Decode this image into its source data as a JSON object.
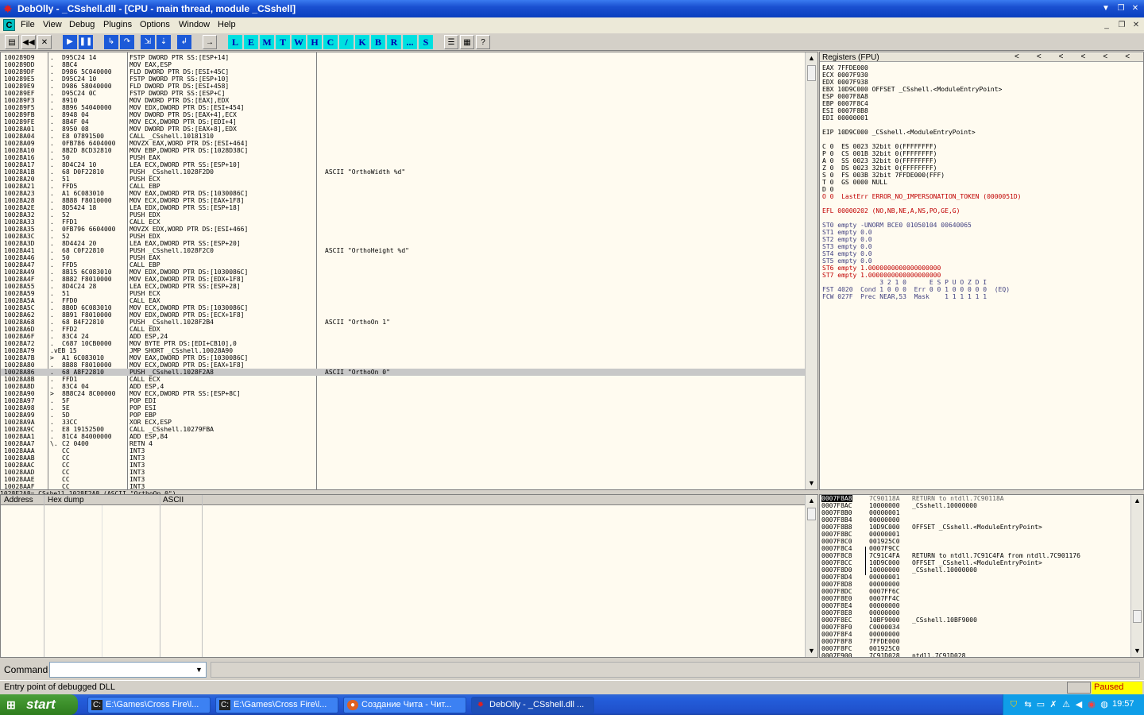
{
  "titlebar": {
    "title": "DebOlly - _CSshell.dll - [CPU - main thread, module _CSshell]"
  },
  "menu": {
    "logo": "C",
    "items": [
      "File",
      "View",
      "Debug",
      "Plugins",
      "Options",
      "Window",
      "Help"
    ]
  },
  "toolbar": {
    "icons": [
      "open-icon",
      "rewind-icon",
      "close-icon",
      "run-icon",
      "pause-icon",
      "step-into-icon",
      "step-over-icon",
      "trace-into-icon",
      "trace-over-icon",
      "execute-till-return-icon",
      "goto-icon"
    ],
    "letters": [
      "L",
      "E",
      "M",
      "T",
      "W",
      "H",
      "C",
      "/",
      "K",
      "B",
      "R",
      "...",
      "S"
    ]
  },
  "disasm": [
    [
      "100289D9",
      ".",
      "D95C24 14",
      "FSTP DWORD PTR SS:[ESP+14]",
      ""
    ],
    [
      "100289DD",
      ".",
      "8BC4",
      "MOV EAX,ESP",
      ""
    ],
    [
      "100289DF",
      ".",
      "D986 5C040000",
      "FLD DWORD PTR DS:[ESI+45C]",
      ""
    ],
    [
      "100289E5",
      ".",
      "D95C24 10",
      "FSTP DWORD PTR SS:[ESP+10]",
      ""
    ],
    [
      "100289E9",
      ".",
      "D986 58040000",
      "FLD DWORD PTR DS:[ESI+458]",
      ""
    ],
    [
      "100289EF",
      ".",
      "D95C24 0C",
      "FSTP DWORD PTR SS:[ESP+C]",
      ""
    ],
    [
      "100289F3",
      ".",
      "8910",
      "MOV DWORD PTR DS:[EAX],EDX",
      ""
    ],
    [
      "100289F5",
      ".",
      "8B96 54040000",
      "MOV EDX,DWORD PTR DS:[ESI+454]",
      ""
    ],
    [
      "100289FB",
      ".",
      "8948 04",
      "MOV DWORD PTR DS:[EAX+4],ECX",
      ""
    ],
    [
      "100289FE",
      ".",
      "8B4F 04",
      "MOV ECX,DWORD PTR DS:[EDI+4]",
      ""
    ],
    [
      "10028A01",
      ".",
      "8950 08",
      "MOV DWORD PTR DS:[EAX+8],EDX",
      ""
    ],
    [
      "10028A04",
      ".",
      "E8 07891500",
      "CALL _CSshell.10181310",
      ""
    ],
    [
      "10028A09",
      ".",
      "0FB786 6404000",
      "MOVZX EAX,WORD PTR DS:[ESI+464]",
      ""
    ],
    [
      "10028A10",
      ".",
      "8B2D 8CD32810",
      "MOV EBP,DWORD PTR DS:[1028D38C]",
      ""
    ],
    [
      "10028A16",
      ".",
      "50",
      "PUSH EAX",
      ""
    ],
    [
      "10028A17",
      ".",
      "8D4C24 10",
      "LEA ECX,DWORD PTR SS:[ESP+10]",
      ""
    ],
    [
      "10028A1B",
      ".",
      "68 D0F22810",
      "PUSH _CSshell.1028F2D0",
      "ASCII \"OrthoWidth %d\""
    ],
    [
      "10028A20",
      ".",
      "51",
      "PUSH ECX",
      ""
    ],
    [
      "10028A21",
      ".",
      "FFD5",
      "CALL EBP",
      ""
    ],
    [
      "10028A23",
      ".",
      "A1 6C083010",
      "MOV EAX,DWORD PTR DS:[1030086C]",
      ""
    ],
    [
      "10028A28",
      ".",
      "8B88 F8010000",
      "MOV ECX,DWORD PTR DS:[EAX+1F8]",
      ""
    ],
    [
      "10028A2E",
      ".",
      "8D5424 18",
      "LEA EDX,DWORD PTR SS:[ESP+18]",
      ""
    ],
    [
      "10028A32",
      ".",
      "52",
      "PUSH EDX",
      ""
    ],
    [
      "10028A33",
      ".",
      "FFD1",
      "CALL ECX",
      ""
    ],
    [
      "10028A35",
      ".",
      "0FB796 6604000",
      "MOVZX EDX,WORD PTR DS:[ESI+466]",
      ""
    ],
    [
      "10028A3C",
      ".",
      "52",
      "PUSH EDX",
      ""
    ],
    [
      "10028A3D",
      ".",
      "8D4424 20",
      "LEA EAX,DWORD PTR SS:[ESP+20]",
      ""
    ],
    [
      "10028A41",
      ".",
      "68 C0F22810",
      "PUSH _CSshell.1028F2C0",
      "ASCII \"OrthoHeight %d\""
    ],
    [
      "10028A46",
      ".",
      "50",
      "PUSH EAX",
      ""
    ],
    [
      "10028A47",
      ".",
      "FFD5",
      "CALL EBP",
      ""
    ],
    [
      "10028A49",
      ".",
      "8B15 6C083010",
      "MOV EDX,DWORD PTR DS:[1030086C]",
      ""
    ],
    [
      "10028A4F",
      ".",
      "8B82 F8010000",
      "MOV EAX,DWORD PTR DS:[EDX+1F8]",
      ""
    ],
    [
      "10028A55",
      ".",
      "8D4C24 28",
      "LEA ECX,DWORD PTR SS:[ESP+28]",
      ""
    ],
    [
      "10028A59",
      ".",
      "51",
      "PUSH ECX",
      ""
    ],
    [
      "10028A5A",
      ".",
      "FFD0",
      "CALL EAX",
      ""
    ],
    [
      "10028A5C",
      ".",
      "8B0D 6C083010",
      "MOV ECX,DWORD PTR DS:[1030086C]",
      ""
    ],
    [
      "10028A62",
      ".",
      "8B91 F8010000",
      "MOV EDX,DWORD PTR DS:[ECX+1F8]",
      ""
    ],
    [
      "10028A68",
      ".",
      "68 B4F22810",
      "PUSH _CSshell.1028F2B4",
      "ASCII \"OrthoOn 1\""
    ],
    [
      "10028A6D",
      ".",
      "FFD2",
      "CALL EDX",
      ""
    ],
    [
      "10028A6F",
      ".",
      "83C4 24",
      "ADD ESP,24",
      ""
    ],
    [
      "10028A72",
      ".",
      "C687 10CB0000",
      "MOV BYTE PTR DS:[EDI+CB10],0",
      ""
    ],
    [
      "10028A79",
      ".vEB 15",
      "",
      "JMP SHORT _CSshell.10028A90",
      ""
    ],
    [
      "10028A7B",
      ">",
      "A1 6C083010",
      "MOV EAX,DWORD PTR DS:[1030086C]",
      ""
    ],
    [
      "10028A80",
      ".",
      "8B88 F8010000",
      "MOV ECX,DWORD PTR DS:[EAX+1F8]",
      ""
    ],
    [
      "10028A86",
      ".",
      "68 A8F22810",
      "PUSH _CSshell.1028F2A8",
      "ASCII \"OrthoOn 0\""
    ],
    [
      "10028A8B",
      ".",
      "FFD1",
      "CALL ECX",
      ""
    ],
    [
      "10028A8D",
      ".",
      "83C4 04",
      "ADD ESP,4",
      ""
    ],
    [
      "10028A90",
      ">",
      "8B8C24 8C00000",
      "MOV ECX,DWORD PTR SS:[ESP+8C]",
      ""
    ],
    [
      "10028A97",
      ".",
      "5F",
      "POP EDI",
      ""
    ],
    [
      "10028A98",
      ".",
      "5E",
      "POP ESI",
      ""
    ],
    [
      "10028A99",
      ".",
      "5D",
      "POP EBP",
      ""
    ],
    [
      "10028A9A",
      ".",
      "33CC",
      "XOR ECX,ESP",
      ""
    ],
    [
      "10028A9C",
      ".",
      "E8 19152500",
      "CALL _CSshell.10279FBA",
      ""
    ],
    [
      "10028AA1",
      ".",
      "81C4 84000000",
      "ADD ESP,84",
      ""
    ],
    [
      "10028AA7",
      "\\.",
      "C2 0400",
      "RETN 4",
      ""
    ],
    [
      "10028AAA",
      "",
      "CC",
      "INT3",
      ""
    ],
    [
      "10028AAB",
      "",
      "CC",
      "INT3",
      ""
    ],
    [
      "10028AAC",
      "",
      "CC",
      "INT3",
      ""
    ],
    [
      "10028AAD",
      "",
      "CC",
      "INT3",
      ""
    ],
    [
      "10028AAE",
      "",
      "CC",
      "INT3",
      ""
    ],
    [
      "10028AAF",
      "",
      "CC",
      "INT3",
      ""
    ]
  ],
  "disasm_selected_index": 44,
  "info_strip": "1028F2A8=_CSshell.1028F2A8 (ASCII \"OrthoOn 0\")",
  "registers": {
    "header": "Registers (FPU)",
    "lines": [
      "EAX 7FFDE000",
      "ECX 0007F930",
      "EDX 0007F938",
      "EBX 10D9C000 OFFSET _CSshell.<ModuleEntryPoint>",
      "ESP 0007F8A8",
      "EBP 0007F8C4",
      "ESI 0007F8B8",
      "EDI 00000001",
      "",
      "EIP 10D9C000 _CSshell.<ModuleEntryPoint>",
      "",
      "C 0  ES 0023 32bit 0(FFFFFFFF)",
      "P 0  CS 001B 32bit 0(FFFFFFFF)",
      "A 0  SS 0023 32bit 0(FFFFFFFF)",
      "Z 0  DS 0023 32bit 0(FFFFFFFF)",
      "S 0  FS 003B 32bit 7FFDE000(FFF)",
      "T 0  GS 0000 NULL",
      "D 0",
      "O 0  LastErr ERROR_NO_IMPERSONATION_TOKEN (0000051D)",
      "",
      "EFL 00000202 (NO,NB,NE,A,NS,PO,GE,G)",
      "",
      "ST0 empty -UNORM BCE0 01050104 00640065",
      "ST1 empty 0.0",
      "ST2 empty 0.0",
      "ST3 empty 0.0",
      "ST4 empty 0.0",
      "ST5 empty 0.0",
      "ST6 empty 1.0000000000000000000",
      "ST7 empty 1.0000000000000000000",
      "               3 2 1 0      E S P U O Z D I",
      "FST 4020  Cond 1 0 0 0  Err 0 0 1 0 0 0 0 0  (EQ)",
      "FCW 027F  Prec NEAR,53  Mask    1 1 1 1 1 1"
    ],
    "highlight_color": "#c00000"
  },
  "dump": {
    "headers": [
      "Address",
      "Hex dump",
      "ASCII"
    ]
  },
  "stack": [
    [
      "0007F8A8",
      "7C90118A",
      "RETURN to ntdll.7C90118A"
    ],
    [
      "0007F8AC",
      "10000000",
      "_CSshell.10000000"
    ],
    [
      "0007F8B0",
      "00000001",
      ""
    ],
    [
      "0007F8B4",
      "00000000",
      ""
    ],
    [
      "0007F8B8",
      "10D9C000",
      "OFFSET _CSshell.<ModuleEntryPoint>"
    ],
    [
      "0007F8BC",
      "00000001",
      ""
    ],
    [
      "0007F8C0",
      "001925C0",
      ""
    ],
    [
      "0007F8C4",
      "0007F9CC",
      ""
    ],
    [
      "0007F8C8",
      "7C91C4FA",
      "RETURN to ntdll.7C91C4FA from ntdll.7C901176"
    ],
    [
      "0007F8CC",
      "10D9C000",
      "OFFSET _CSshell.<ModuleEntryPoint>"
    ],
    [
      "0007F8D0",
      "10000000",
      "_CSshell.10000000"
    ],
    [
      "0007F8D4",
      "00000001",
      ""
    ],
    [
      "0007F8D8",
      "00000000",
      ""
    ],
    [
      "0007F8DC",
      "0007FF6C",
      ""
    ],
    [
      "0007F8E0",
      "0007FF4C",
      ""
    ],
    [
      "0007F8E4",
      "00000000",
      ""
    ],
    [
      "0007F8E8",
      "00000000",
      ""
    ],
    [
      "0007F8EC",
      "10BF9000",
      "_CSshell.10BF9000"
    ],
    [
      "0007F8F0",
      "C0000034",
      ""
    ],
    [
      "0007F8F4",
      "00000000",
      ""
    ],
    [
      "0007F8F8",
      "7FFDE000",
      ""
    ],
    [
      "0007F8FC",
      "001925C0",
      ""
    ],
    [
      "0007F900",
      "7C91D028",
      "ntdll.7C91D028"
    ]
  ],
  "command": {
    "label": "Command",
    "value": ""
  },
  "status": {
    "message": "Entry point of debugged DLL",
    "state": "Paused"
  },
  "taskbar": {
    "start": "start",
    "tasks": [
      {
        "label": "E:\\Games\\Cross Fire\\l...",
        "icon": "cmd-icon"
      },
      {
        "label": "E:\\Games\\Cross Fire\\l...",
        "icon": "cmd-icon"
      },
      {
        "label": "Создание Чита - Чит...",
        "icon": "firefox-icon"
      },
      {
        "label": "DebOlly - _CSshell.dll ...",
        "icon": "debolly-icon"
      }
    ],
    "clock": "19:57"
  }
}
